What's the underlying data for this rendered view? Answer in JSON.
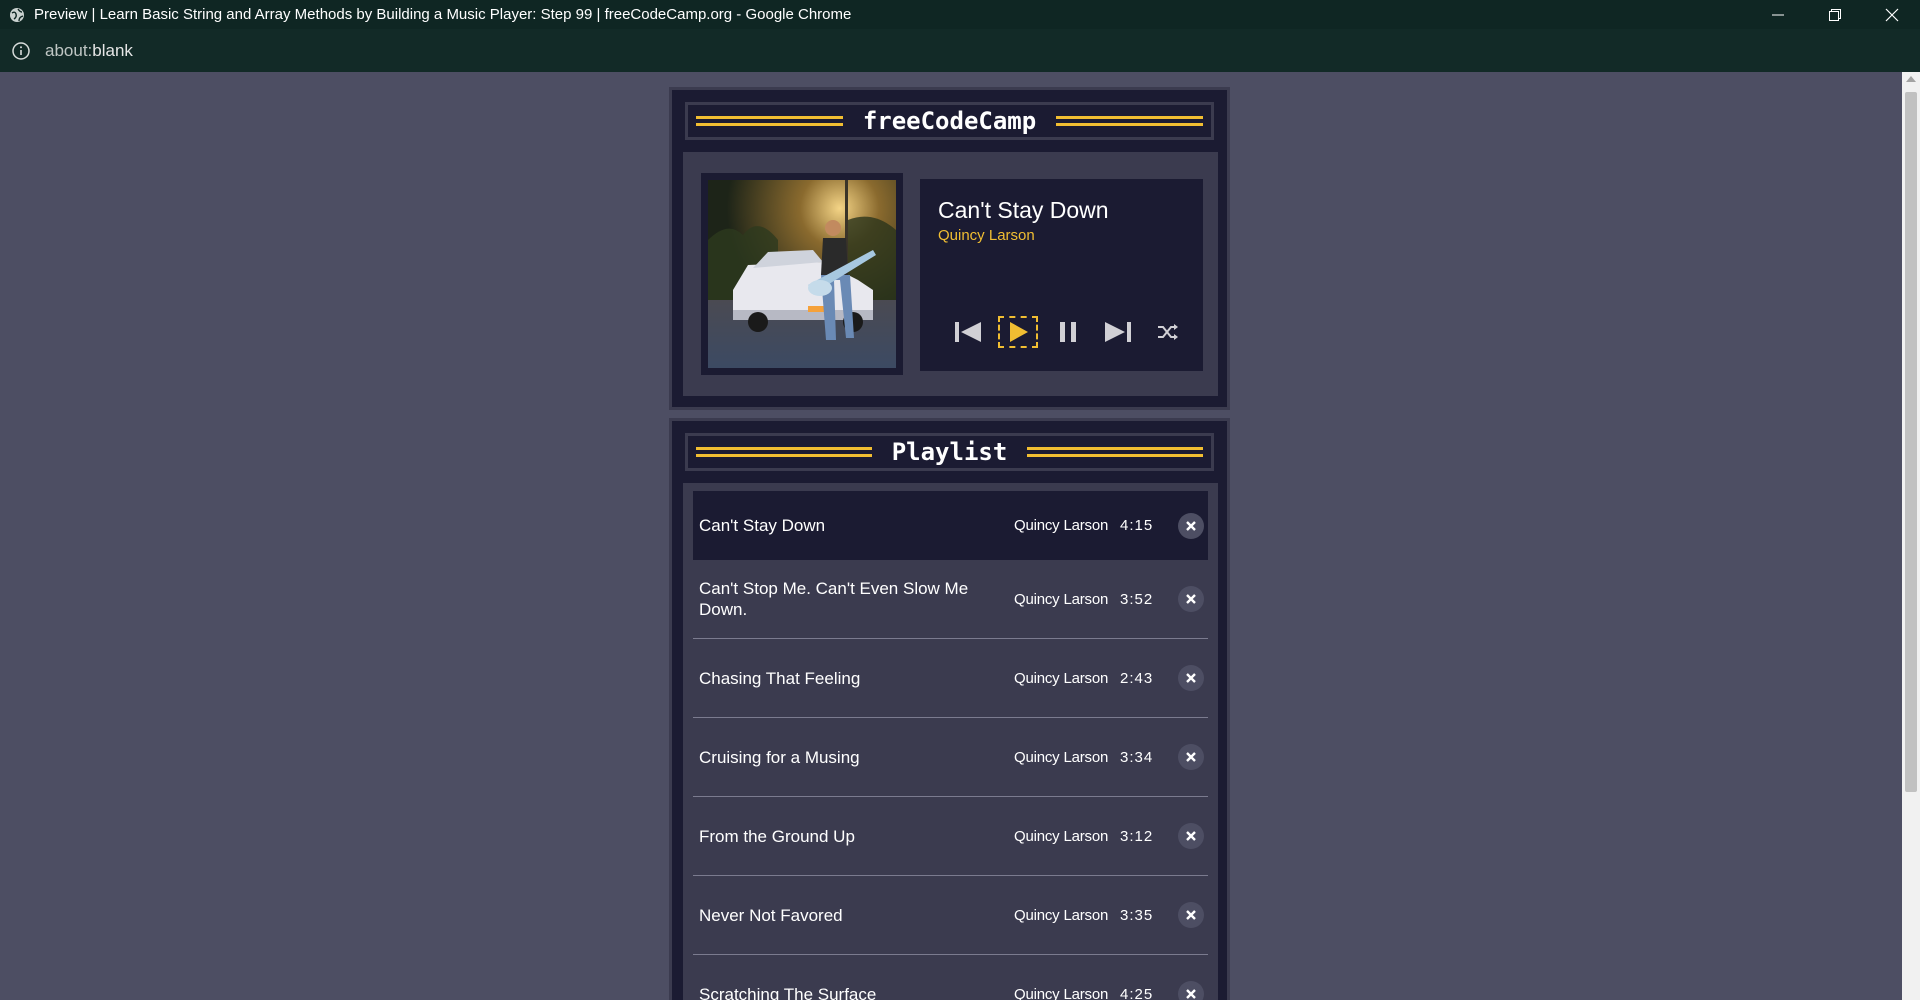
{
  "browser": {
    "window_title": "Preview | Learn Basic String and Array Methods by Building a Music Player: Step 99 | freeCodeCamp.org - Google Chrome",
    "url_prefix": "about:",
    "url_rest": "blank"
  },
  "player": {
    "header_title": "freeCodeCamp",
    "current_song": {
      "title": "Can't Stay Down",
      "artist": "Quincy Larson"
    },
    "controls": [
      {
        "name": "previous",
        "icon": "previous-icon"
      },
      {
        "name": "play",
        "icon": "play-icon"
      },
      {
        "name": "pause",
        "icon": "pause-icon"
      },
      {
        "name": "next",
        "icon": "next-icon"
      },
      {
        "name": "shuffle",
        "icon": "shuffle-icon"
      }
    ]
  },
  "playlist": {
    "header_title": "Playlist",
    "songs": [
      {
        "title": "Can't Stay Down",
        "artist": "Quincy Larson",
        "duration": "4:15"
      },
      {
        "title": "Can't Stop Me. Can't Even Slow Me Down.",
        "artist": "Quincy Larson",
        "duration": "3:52"
      },
      {
        "title": "Chasing That Feeling",
        "artist": "Quincy Larson",
        "duration": "2:43"
      },
      {
        "title": "Cruising for a Musing",
        "artist": "Quincy Larson",
        "duration": "3:34"
      },
      {
        "title": "From the Ground Up",
        "artist": "Quincy Larson",
        "duration": "3:12"
      },
      {
        "title": "Never Not Favored",
        "artist": "Quincy Larson",
        "duration": "3:35"
      },
      {
        "title": "Scratching The Surface",
        "artist": "Quincy Larson",
        "duration": "4:25"
      }
    ]
  },
  "colors": {
    "accent": "#f1be32",
    "panel_dark": "#1b1b32",
    "panel_mid": "#3b3b4f",
    "background": "#4d4e63"
  }
}
